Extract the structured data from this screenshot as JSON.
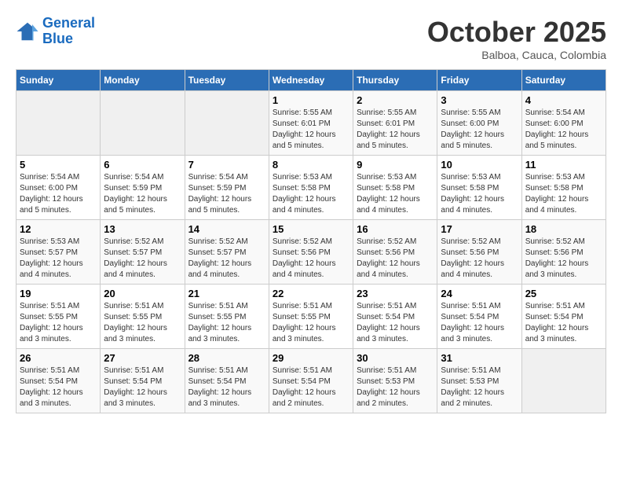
{
  "header": {
    "logo_line1": "General",
    "logo_line2": "Blue",
    "month": "October 2025",
    "location": "Balboa, Cauca, Colombia"
  },
  "days_of_week": [
    "Sunday",
    "Monday",
    "Tuesday",
    "Wednesday",
    "Thursday",
    "Friday",
    "Saturday"
  ],
  "weeks": [
    [
      {
        "num": "",
        "empty": true
      },
      {
        "num": "",
        "empty": true
      },
      {
        "num": "",
        "empty": true
      },
      {
        "num": "1",
        "sunrise": "Sunrise: 5:55 AM",
        "sunset": "Sunset: 6:01 PM",
        "daylight": "Daylight: 12 hours and 5 minutes."
      },
      {
        "num": "2",
        "sunrise": "Sunrise: 5:55 AM",
        "sunset": "Sunset: 6:01 PM",
        "daylight": "Daylight: 12 hours and 5 minutes."
      },
      {
        "num": "3",
        "sunrise": "Sunrise: 5:55 AM",
        "sunset": "Sunset: 6:00 PM",
        "daylight": "Daylight: 12 hours and 5 minutes."
      },
      {
        "num": "4",
        "sunrise": "Sunrise: 5:54 AM",
        "sunset": "Sunset: 6:00 PM",
        "daylight": "Daylight: 12 hours and 5 minutes."
      }
    ],
    [
      {
        "num": "5",
        "sunrise": "Sunrise: 5:54 AM",
        "sunset": "Sunset: 6:00 PM",
        "daylight": "Daylight: 12 hours and 5 minutes."
      },
      {
        "num": "6",
        "sunrise": "Sunrise: 5:54 AM",
        "sunset": "Sunset: 5:59 PM",
        "daylight": "Daylight: 12 hours and 5 minutes."
      },
      {
        "num": "7",
        "sunrise": "Sunrise: 5:54 AM",
        "sunset": "Sunset: 5:59 PM",
        "daylight": "Daylight: 12 hours and 5 minutes."
      },
      {
        "num": "8",
        "sunrise": "Sunrise: 5:53 AM",
        "sunset": "Sunset: 5:58 PM",
        "daylight": "Daylight: 12 hours and 4 minutes."
      },
      {
        "num": "9",
        "sunrise": "Sunrise: 5:53 AM",
        "sunset": "Sunset: 5:58 PM",
        "daylight": "Daylight: 12 hours and 4 minutes."
      },
      {
        "num": "10",
        "sunrise": "Sunrise: 5:53 AM",
        "sunset": "Sunset: 5:58 PM",
        "daylight": "Daylight: 12 hours and 4 minutes."
      },
      {
        "num": "11",
        "sunrise": "Sunrise: 5:53 AM",
        "sunset": "Sunset: 5:58 PM",
        "daylight": "Daylight: 12 hours and 4 minutes."
      }
    ],
    [
      {
        "num": "12",
        "sunrise": "Sunrise: 5:53 AM",
        "sunset": "Sunset: 5:57 PM",
        "daylight": "Daylight: 12 hours and 4 minutes."
      },
      {
        "num": "13",
        "sunrise": "Sunrise: 5:52 AM",
        "sunset": "Sunset: 5:57 PM",
        "daylight": "Daylight: 12 hours and 4 minutes."
      },
      {
        "num": "14",
        "sunrise": "Sunrise: 5:52 AM",
        "sunset": "Sunset: 5:57 PM",
        "daylight": "Daylight: 12 hours and 4 minutes."
      },
      {
        "num": "15",
        "sunrise": "Sunrise: 5:52 AM",
        "sunset": "Sunset: 5:56 PM",
        "daylight": "Daylight: 12 hours and 4 minutes."
      },
      {
        "num": "16",
        "sunrise": "Sunrise: 5:52 AM",
        "sunset": "Sunset: 5:56 PM",
        "daylight": "Daylight: 12 hours and 4 minutes."
      },
      {
        "num": "17",
        "sunrise": "Sunrise: 5:52 AM",
        "sunset": "Sunset: 5:56 PM",
        "daylight": "Daylight: 12 hours and 4 minutes."
      },
      {
        "num": "18",
        "sunrise": "Sunrise: 5:52 AM",
        "sunset": "Sunset: 5:56 PM",
        "daylight": "Daylight: 12 hours and 3 minutes."
      }
    ],
    [
      {
        "num": "19",
        "sunrise": "Sunrise: 5:51 AM",
        "sunset": "Sunset: 5:55 PM",
        "daylight": "Daylight: 12 hours and 3 minutes."
      },
      {
        "num": "20",
        "sunrise": "Sunrise: 5:51 AM",
        "sunset": "Sunset: 5:55 PM",
        "daylight": "Daylight: 12 hours and 3 minutes."
      },
      {
        "num": "21",
        "sunrise": "Sunrise: 5:51 AM",
        "sunset": "Sunset: 5:55 PM",
        "daylight": "Daylight: 12 hours and 3 minutes."
      },
      {
        "num": "22",
        "sunrise": "Sunrise: 5:51 AM",
        "sunset": "Sunset: 5:55 PM",
        "daylight": "Daylight: 12 hours and 3 minutes."
      },
      {
        "num": "23",
        "sunrise": "Sunrise: 5:51 AM",
        "sunset": "Sunset: 5:54 PM",
        "daylight": "Daylight: 12 hours and 3 minutes."
      },
      {
        "num": "24",
        "sunrise": "Sunrise: 5:51 AM",
        "sunset": "Sunset: 5:54 PM",
        "daylight": "Daylight: 12 hours and 3 minutes."
      },
      {
        "num": "25",
        "sunrise": "Sunrise: 5:51 AM",
        "sunset": "Sunset: 5:54 PM",
        "daylight": "Daylight: 12 hours and 3 minutes."
      }
    ],
    [
      {
        "num": "26",
        "sunrise": "Sunrise: 5:51 AM",
        "sunset": "Sunset: 5:54 PM",
        "daylight": "Daylight: 12 hours and 3 minutes."
      },
      {
        "num": "27",
        "sunrise": "Sunrise: 5:51 AM",
        "sunset": "Sunset: 5:54 PM",
        "daylight": "Daylight: 12 hours and 3 minutes."
      },
      {
        "num": "28",
        "sunrise": "Sunrise: 5:51 AM",
        "sunset": "Sunset: 5:54 PM",
        "daylight": "Daylight: 12 hours and 3 minutes."
      },
      {
        "num": "29",
        "sunrise": "Sunrise: 5:51 AM",
        "sunset": "Sunset: 5:54 PM",
        "daylight": "Daylight: 12 hours and 2 minutes."
      },
      {
        "num": "30",
        "sunrise": "Sunrise: 5:51 AM",
        "sunset": "Sunset: 5:53 PM",
        "daylight": "Daylight: 12 hours and 2 minutes."
      },
      {
        "num": "31",
        "sunrise": "Sunrise: 5:51 AM",
        "sunset": "Sunset: 5:53 PM",
        "daylight": "Daylight: 12 hours and 2 minutes."
      },
      {
        "num": "",
        "empty": true
      }
    ]
  ]
}
